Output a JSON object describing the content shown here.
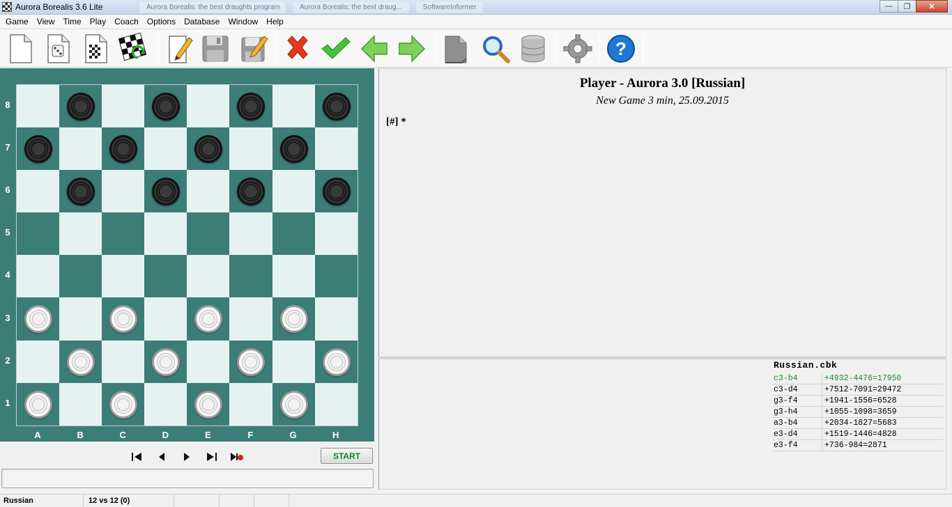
{
  "window": {
    "title": "Aurora Borealis 3.6 Lite",
    "background_tabs": [
      "Aurora Borealis: the best draughts program",
      "Aurora Borealis: the best draug...",
      "SoftwareInformer"
    ]
  },
  "menu": [
    "Game",
    "View",
    "Time",
    "Play",
    "Coach",
    "Options",
    "Database",
    "Window",
    "Help"
  ],
  "toolbar": {
    "buttons": [
      "new-game-icon",
      "random-position-icon",
      "board-setup-icon",
      "flip-board-icon",
      "edit-icon",
      "save-icon",
      "save-edit-icon",
      "delete-icon",
      "accept-icon",
      "back-arrow-icon",
      "forward-arrow-icon",
      "document-icon",
      "search-icon",
      "database-icon",
      "settings-icon",
      "help-icon"
    ]
  },
  "board": {
    "ranks": [
      "8",
      "7",
      "6",
      "5",
      "4",
      "3",
      "2",
      "1"
    ],
    "files": [
      "A",
      "B",
      "C",
      "D",
      "E",
      "F",
      "G",
      "H"
    ],
    "light_color": "#e6f2f1",
    "dark_color": "#3d7d78",
    "position": [
      [
        0,
        "b",
        0,
        "b",
        0,
        "b",
        0,
        "b"
      ],
      [
        "b",
        0,
        "b",
        0,
        "b",
        0,
        "b",
        0
      ],
      [
        0,
        "b",
        0,
        "b",
        0,
        "b",
        0,
        "b"
      ],
      [
        0,
        0,
        0,
        0,
        0,
        0,
        0,
        0
      ],
      [
        0,
        0,
        0,
        0,
        0,
        0,
        0,
        0
      ],
      [
        "w",
        0,
        "w",
        0,
        "w",
        0,
        "w",
        0
      ],
      [
        0,
        "w",
        0,
        "w",
        0,
        "w",
        0,
        "w"
      ],
      [
        "w",
        0,
        "w",
        0,
        "w",
        0,
        "w",
        0
      ]
    ]
  },
  "controls": {
    "start_label": "START",
    "nav_icons": [
      "first-move-icon",
      "previous-move-icon",
      "next-move-icon",
      "last-move-icon",
      "play-record-icon"
    ]
  },
  "notation": {
    "title": "Player - Aurora 3.0 [Russian]",
    "subtitle": "New Game 3 min, 25.09.2015",
    "moves": "[#]  *"
  },
  "opening_book": {
    "file": "Russian.cbk",
    "entries": [
      {
        "move": "c3-b4",
        "stats": "+4932-4476=17950"
      },
      {
        "move": "c3-d4",
        "stats": "+7512-7091=29472"
      },
      {
        "move": "g3-f4",
        "stats": "+1941-1556=6528"
      },
      {
        "move": "g3-h4",
        "stats": "+1055-1098=3659"
      },
      {
        "move": "a3-b4",
        "stats": "+2034-1827=5683"
      },
      {
        "move": "e3-d4",
        "stats": "+1519-1446=4828"
      },
      {
        "move": "e3-f4",
        "stats": "+736-984=2871"
      }
    ]
  },
  "statusbar": {
    "variant": "Russian",
    "material": "12 vs 12  (0)"
  }
}
